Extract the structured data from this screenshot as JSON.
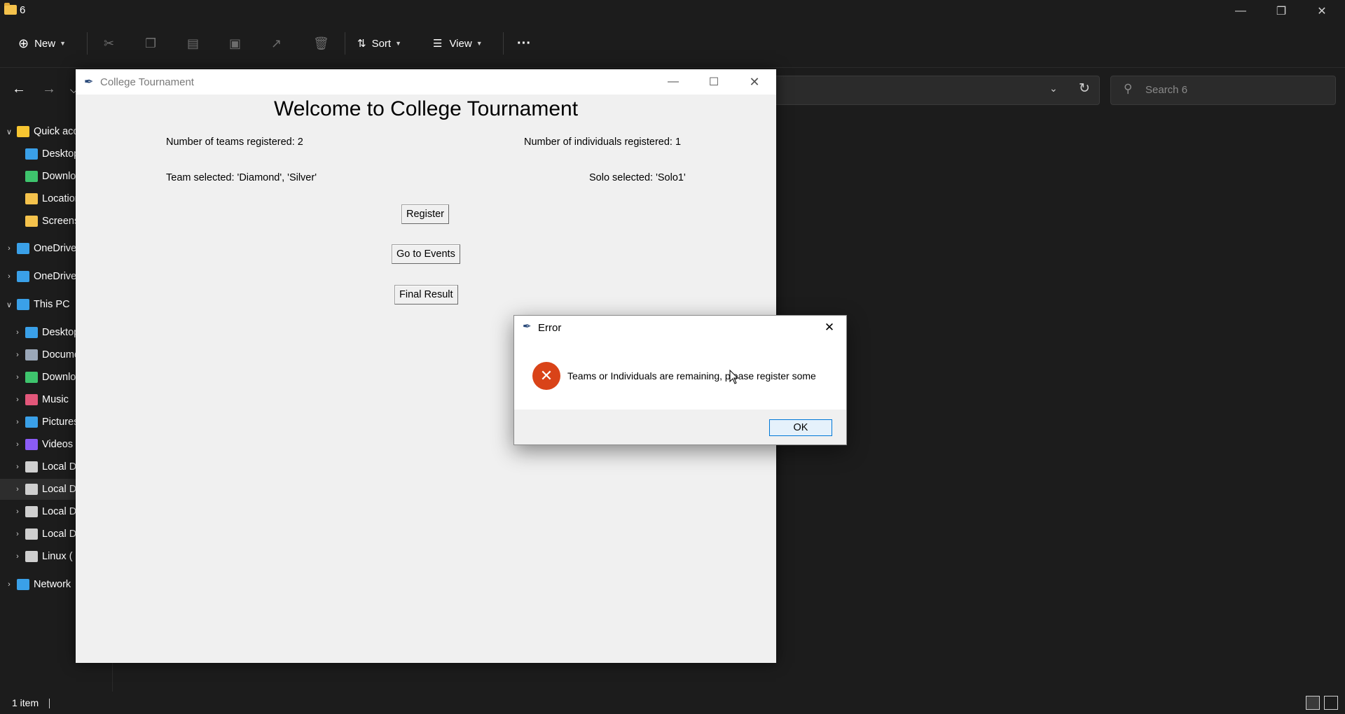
{
  "explorer": {
    "window_title": "6",
    "toolbar": {
      "new_label": "New",
      "sort_label": "Sort",
      "view_label": "View",
      "more_label": "···"
    },
    "search_placeholder": "Search 6",
    "sidebar": [
      {
        "label": "Quick access",
        "icon": "star-icon",
        "color": "#f7c531",
        "expanded": true
      },
      {
        "label": "Desktop",
        "icon": "desktop-icon",
        "color": "#3aa0e8"
      },
      {
        "label": "Downloads",
        "icon": "download-icon",
        "color": "#3ec46d"
      },
      {
        "label": "Locations",
        "icon": "folder-icon",
        "color": "#f4c24c"
      },
      {
        "label": "Screenshots",
        "icon": "folder-icon",
        "color": "#f4c24c"
      },
      {
        "label": "OneDrive",
        "icon": "cloud-icon",
        "color": "#3aa0e8"
      },
      {
        "label": "OneDrive",
        "icon": "cloud-icon",
        "color": "#3aa0e8"
      },
      {
        "label": "This PC",
        "icon": "computer-icon",
        "color": "#3aa0e8",
        "expanded": true
      },
      {
        "label": "Desktop",
        "icon": "desktop-icon",
        "color": "#3aa0e8"
      },
      {
        "label": "Documents",
        "icon": "document-icon",
        "color": "#9aa7b8"
      },
      {
        "label": "Downloads",
        "icon": "download-icon",
        "color": "#3ec46d"
      },
      {
        "label": "Music",
        "icon": "music-icon",
        "color": "#e2577a"
      },
      {
        "label": "Pictures",
        "icon": "pictures-icon",
        "color": "#3aa0e8"
      },
      {
        "label": "Videos",
        "icon": "video-icon",
        "color": "#8b5cf6"
      },
      {
        "label": "Local Disk",
        "icon": "drive-icon",
        "color": "#cfcfcf"
      },
      {
        "label": "Local Disk",
        "icon": "drive-icon",
        "color": "#cfcfcf",
        "selected": true
      },
      {
        "label": "Local Disk",
        "icon": "drive-icon",
        "color": "#cfcfcf"
      },
      {
        "label": "Local Disk",
        "icon": "drive-icon",
        "color": "#cfcfcf"
      },
      {
        "label": "Linux (",
        "icon": "drive-icon",
        "color": "#cfcfcf"
      },
      {
        "label": "Network",
        "icon": "network-icon",
        "color": "#3aa0e8"
      }
    ],
    "status": "1 item"
  },
  "app": {
    "title": "College Tournament",
    "welcome": "Welcome to College Tournament",
    "teams_count": "Number of teams registered: 2",
    "individuals_count": "Number of individuals registered: 1",
    "team_selected": "Team selected: 'Diamond', 'Silver'",
    "solo_selected": "Solo selected: 'Solo1'",
    "buttons": {
      "register": "Register",
      "events": "Go to Events",
      "final": "Final Result"
    }
  },
  "dialog": {
    "title": "Error",
    "message": "Teams or Individuals are remaining, please register some",
    "ok": "OK"
  }
}
